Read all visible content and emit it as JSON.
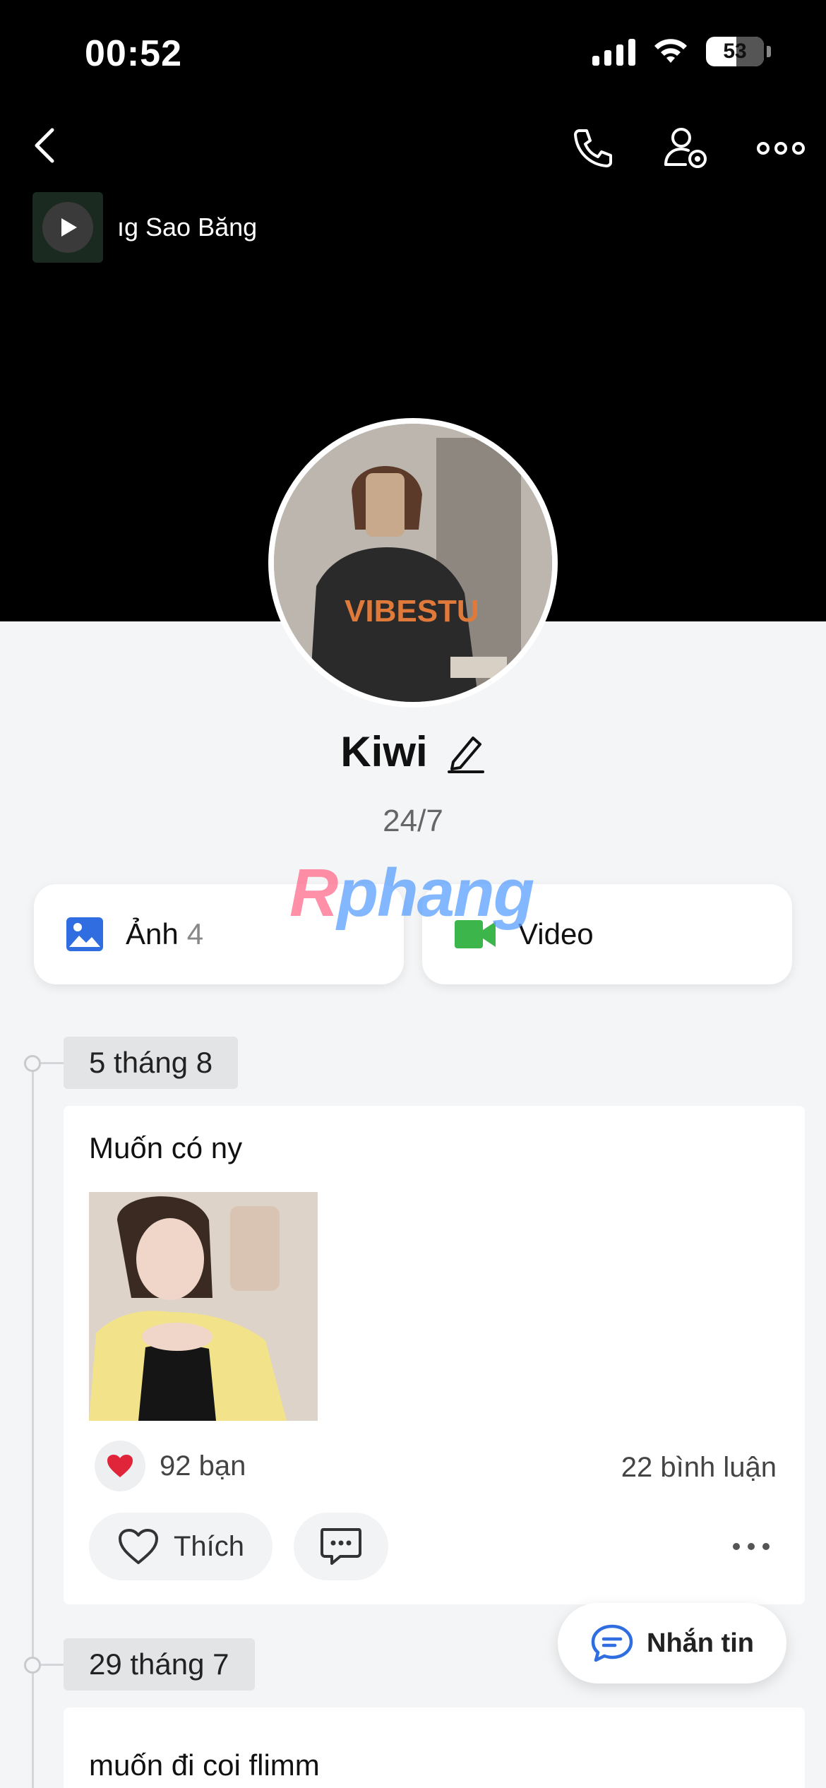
{
  "status_bar": {
    "time": "00:52",
    "battery": "53"
  },
  "header": {
    "icons": [
      "back-icon",
      "phone-icon",
      "user-settings-icon",
      "more-icon"
    ],
    "music": {
      "title": "ıg Sao Băng",
      "play_icon": "play-icon"
    }
  },
  "profile": {
    "name": "Kiwi",
    "bio": "24/7",
    "edit_icon": "pencil-icon"
  },
  "watermark": {
    "text_r": "R",
    "text_rest": "phang"
  },
  "media": {
    "photos_label": "Ảnh",
    "photos_count": "4",
    "video_label": "Video",
    "photo_icon_color": "#2f6de1",
    "video_icon_color": "#3cb54a"
  },
  "timeline": [
    {
      "date": "5 tháng 8",
      "text": "Muốn có ny",
      "reactions": "92 bạn",
      "comments": "22 bình luận",
      "like_label": "Thích"
    },
    {
      "date": "29 tháng 7",
      "text": "muốn đi coi flimm"
    }
  ],
  "message_button": {
    "label": "Nhắn tin"
  },
  "colors": {
    "cover": "#000000",
    "background": "#f4f5f6",
    "heart": "#e0243a",
    "accent": "#2f6de1"
  }
}
